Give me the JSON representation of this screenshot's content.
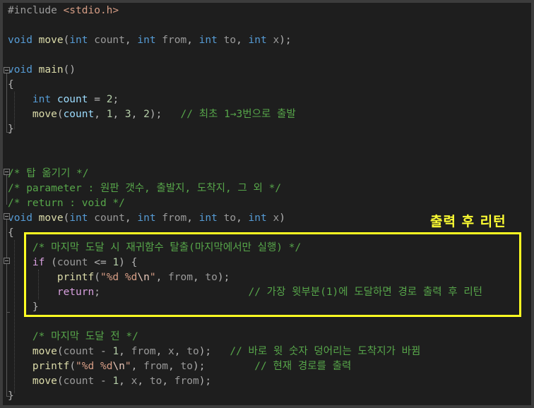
{
  "annotation": {
    "label": "출력 후 리턴",
    "color": "#ffff22"
  },
  "colors": {
    "background": "#1e1e1e",
    "keyword": "#569cd6",
    "control": "#d8a0df",
    "variable": "#9cdcfe",
    "parameter": "#9a9a9a",
    "function": "#dcdcaa",
    "string": "#d69d85",
    "number": "#b5cea8",
    "comment": "#57a64a"
  },
  "code_lines": [
    [
      [
        "pp",
        "#include "
      ],
      [
        "inc",
        "<stdio.h>"
      ]
    ],
    [],
    [
      [
        "kw",
        "void "
      ],
      [
        "fn",
        "move"
      ],
      [
        "pun",
        "("
      ],
      [
        "kw",
        "int "
      ],
      [
        "prm",
        "count"
      ],
      [
        "pun",
        ", "
      ],
      [
        "kw",
        "int "
      ],
      [
        "prm",
        "from"
      ],
      [
        "pun",
        ", "
      ],
      [
        "kw",
        "int "
      ],
      [
        "prm",
        "to"
      ],
      [
        "pun",
        ", "
      ],
      [
        "kw",
        "int "
      ],
      [
        "prm",
        "x"
      ],
      [
        "pun",
        ");"
      ]
    ],
    [],
    [
      [
        "kw",
        "void "
      ],
      [
        "fn",
        "main"
      ],
      [
        "pun",
        "()"
      ]
    ],
    [
      [
        "pun",
        "{"
      ]
    ],
    [
      [
        "txt",
        "    "
      ],
      [
        "kw",
        "int "
      ],
      [
        "var",
        "count"
      ],
      [
        "pun",
        " = "
      ],
      [
        "num",
        "2"
      ],
      [
        "pun",
        ";"
      ]
    ],
    [
      [
        "txt",
        "    "
      ],
      [
        "fn",
        "move"
      ],
      [
        "pun",
        "("
      ],
      [
        "var",
        "count"
      ],
      [
        "pun",
        ", "
      ],
      [
        "num",
        "1"
      ],
      [
        "pun",
        ", "
      ],
      [
        "num",
        "3"
      ],
      [
        "pun",
        ", "
      ],
      [
        "num",
        "2"
      ],
      [
        "pun",
        ");   "
      ],
      [
        "cmt",
        "// 최초 1→3번으로 출발"
      ]
    ],
    [
      [
        "pun",
        "}"
      ]
    ],
    [],
    [],
    [
      [
        "cmt",
        "/* 탑 옮기기 */"
      ]
    ],
    [
      [
        "cmt",
        "/* parameter : 원판 갯수, 출발지, 도착지, 그 외 */"
      ]
    ],
    [
      [
        "cmt",
        "/* return : void */"
      ]
    ],
    [
      [
        "kw",
        "void "
      ],
      [
        "fn",
        "move"
      ],
      [
        "pun",
        "("
      ],
      [
        "kw",
        "int "
      ],
      [
        "prm",
        "count"
      ],
      [
        "pun",
        ", "
      ],
      [
        "kw",
        "int "
      ],
      [
        "prm",
        "from"
      ],
      [
        "pun",
        ", "
      ],
      [
        "kw",
        "int "
      ],
      [
        "prm",
        "to"
      ],
      [
        "pun",
        ", "
      ],
      [
        "kw",
        "int "
      ],
      [
        "prm",
        "x"
      ],
      [
        "pun",
        ")"
      ]
    ],
    [
      [
        "pun",
        "{"
      ]
    ],
    [
      [
        "txt",
        "    "
      ],
      [
        "cmt",
        "/* 마지막 도달 시 재귀함수 탈출(마지막에서만 실행) */"
      ]
    ],
    [
      [
        "txt",
        "    "
      ],
      [
        "ctl",
        "if "
      ],
      [
        "pun",
        "("
      ],
      [
        "prm",
        "count"
      ],
      [
        "pun",
        " <= "
      ],
      [
        "num",
        "1"
      ],
      [
        "pun",
        ") {"
      ]
    ],
    [
      [
        "txt",
        "        "
      ],
      [
        "fn",
        "printf"
      ],
      [
        "pun",
        "("
      ],
      [
        "str",
        "\"%d %d"
      ],
      [
        "esc",
        "\\n"
      ],
      [
        "str",
        "\""
      ],
      [
        "pun",
        ", "
      ],
      [
        "prm",
        "from"
      ],
      [
        "pun",
        ", "
      ],
      [
        "prm",
        "to"
      ],
      [
        "pun",
        ");"
      ]
    ],
    [
      [
        "txt",
        "        "
      ],
      [
        "ctl",
        "return"
      ],
      [
        "pun",
        ";                        "
      ],
      [
        "cmt",
        "// 가장 윗부분(1)에 도달하면 경로 출력 후 리턴"
      ]
    ],
    [
      [
        "txt",
        "    "
      ],
      [
        "pun",
        "}"
      ]
    ],
    [],
    [
      [
        "txt",
        "    "
      ],
      [
        "cmt",
        "/* 마지막 도달 전 */"
      ]
    ],
    [
      [
        "txt",
        "    "
      ],
      [
        "fn",
        "move"
      ],
      [
        "pun",
        "("
      ],
      [
        "prm",
        "count"
      ],
      [
        "pun",
        " - "
      ],
      [
        "num",
        "1"
      ],
      [
        "pun",
        ", "
      ],
      [
        "prm",
        "from"
      ],
      [
        "pun",
        ", "
      ],
      [
        "prm",
        "x"
      ],
      [
        "pun",
        ", "
      ],
      [
        "prm",
        "to"
      ],
      [
        "pun",
        ");   "
      ],
      [
        "cmt",
        "// 바로 윗 숫자 덩어리는 도착지가 바뀜"
      ]
    ],
    [
      [
        "txt",
        "    "
      ],
      [
        "fn",
        "printf"
      ],
      [
        "pun",
        "("
      ],
      [
        "str",
        "\"%d %d"
      ],
      [
        "esc",
        "\\n"
      ],
      [
        "str",
        "\""
      ],
      [
        "pun",
        ", "
      ],
      [
        "prm",
        "from"
      ],
      [
        "pun",
        ", "
      ],
      [
        "prm",
        "to"
      ],
      [
        "pun",
        ");        "
      ],
      [
        "cmt",
        "// 현재 경로를 출력"
      ]
    ],
    [
      [
        "txt",
        "    "
      ],
      [
        "fn",
        "move"
      ],
      [
        "pun",
        "("
      ],
      [
        "prm",
        "count"
      ],
      [
        "pun",
        " - "
      ],
      [
        "num",
        "1"
      ],
      [
        "pun",
        ", "
      ],
      [
        "prm",
        "x"
      ],
      [
        "pun",
        ", "
      ],
      [
        "prm",
        "to"
      ],
      [
        "pun",
        ", "
      ],
      [
        "prm",
        "from"
      ],
      [
        "pun",
        ");"
      ]
    ],
    [
      [
        "pun",
        "}"
      ]
    ]
  ]
}
